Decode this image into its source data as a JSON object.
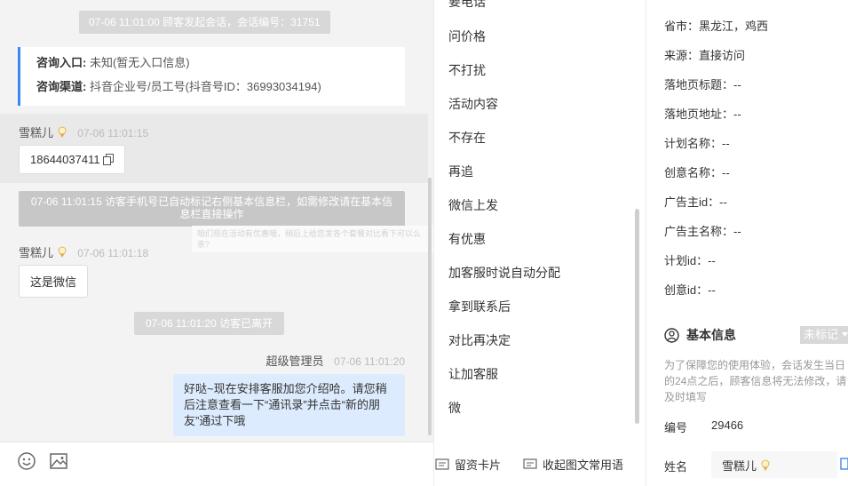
{
  "chat": {
    "session_start": "07-06 11:01:00 顾客发起会话，会话编号：31751",
    "entry_label": "咨询入口:",
    "entry_value": "未知(暂无入口信息)",
    "channel_label": "咨询渠道:",
    "channel_value": "抖音企业号/员工号(抖音号ID：36993034194)",
    "msg1": {
      "sender": "雪糕儿",
      "time": "07-06 11:01:15",
      "text": "18644037411"
    },
    "auto_notice": "07-06 11:01:15 访客手机号已自动标记右侧基本信息栏，如需修改请在基本信息栏直接操作",
    "tooltip_text": "咱们现在活动有优惠哦，稍后上给您发各个套餐对比看下可以么亲?",
    "msg2": {
      "sender": "雪糕儿",
      "time": "07-06 11:01:18",
      "text": "这是微信"
    },
    "visitor_left": "07-06 11:01:20 访客已离开",
    "agent": {
      "name": "超级管理员",
      "time": "07-06 11:01:20",
      "text": "好哒~现在安排客服加您介绍哈。请您稍后注意查看一下“通讯录”并点击“新的朋友”通过下哦"
    },
    "emoji_icon": "smile-icon",
    "image_icon": "image-icon"
  },
  "quick_replies": {
    "items": [
      "要电话",
      "问价格",
      "不打扰",
      "活动内容",
      "不存在",
      "再追",
      "微信上发",
      "有优惠",
      "加客服时说自动分配",
      "拿到联系后",
      "对比再决定",
      "让加客服",
      "微"
    ],
    "leave_card": "留资卡片",
    "collapse": "收起图文常用语"
  },
  "details": {
    "province": "省市：黑龙江，鸡西",
    "source": "来源：直接访问",
    "landing_title": "落地页标题：--",
    "landing_url": "落地页地址：--",
    "plan_name": "计划名称：--",
    "creative_name": "创意名称：--",
    "advertiser_id": "广告主id：--",
    "advertiser_name": "广告主名称：--",
    "plan_id": "计划id：--",
    "creative_id": "创意id：--",
    "basic_info_title": "基本信息",
    "tag_select": "未标记",
    "hint": "为了保障您的使用体验，会话发生当日的24点之后，顾客信息将无法修改，请及时填写",
    "number_label": "编号",
    "number_value": "29466",
    "name_label": "姓名",
    "name_value": "雪糕儿"
  }
}
